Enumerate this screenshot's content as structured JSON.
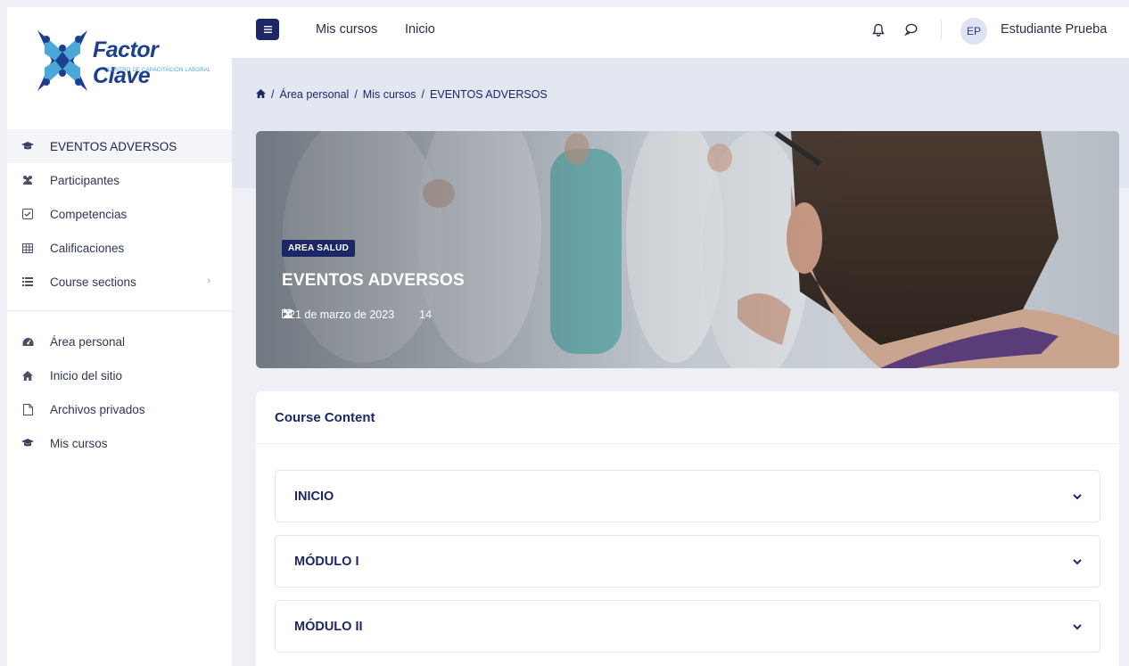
{
  "brand": {
    "name": "Factor Clave",
    "tagline": "CENTRO DE CAPACITACIÓN LABORAL"
  },
  "sidebar": {
    "course_items": [
      {
        "label": "EVENTOS ADVERSOS",
        "icon": "graduation-cap-icon",
        "active": true
      },
      {
        "label": "Participantes",
        "icon": "users-icon"
      },
      {
        "label": "Competencias",
        "icon": "checkbox-icon"
      },
      {
        "label": "Calificaciones",
        "icon": "table-icon"
      },
      {
        "label": "Course sections",
        "icon": "list-icon",
        "has_submenu": true
      }
    ],
    "site_items": [
      {
        "label": "Área personal",
        "icon": "dashboard-icon"
      },
      {
        "label": "Inicio del sitio",
        "icon": "home-icon"
      },
      {
        "label": "Archivos privados",
        "icon": "file-icon"
      },
      {
        "label": "Mis cursos",
        "icon": "graduation-cap-icon"
      }
    ]
  },
  "topbar": {
    "menu_icon": "hamburger-icon",
    "links": [
      "Mis cursos",
      "Inicio"
    ],
    "notification_icon": "bell-icon",
    "messages_icon": "chat-bubble-icon",
    "user_initials": "EP",
    "user_name": "Estudiante Prueba"
  },
  "breadcrumb": {
    "home_icon": "home-icon",
    "items": [
      "Área personal",
      "Mis cursos",
      "EVENTOS ADVERSOS"
    ],
    "separator": "/"
  },
  "hero": {
    "category": "AREA SALUD",
    "title": "EVENTOS ADVERSOS",
    "date": "21 de marzo de 2023",
    "participants": "14"
  },
  "content": {
    "title": "Course Content",
    "sections": [
      "INICIO",
      "MÓDULO I",
      "MÓDULO II"
    ]
  },
  "colors": {
    "primary": "#1d2766",
    "background": "#eef0f5",
    "header_band": "#e3e7f1"
  }
}
